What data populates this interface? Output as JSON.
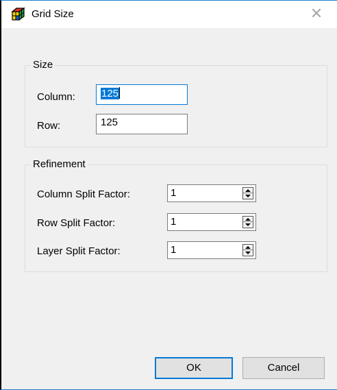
{
  "window": {
    "title": "Grid Size",
    "close_glyph": "✕",
    "icon": "grid-cube-icon"
  },
  "size_group": {
    "legend": "Size",
    "column_label": "Column:",
    "column_value": "125",
    "row_label": "Row:",
    "row_value": "125"
  },
  "refinement_group": {
    "legend": "Refinement",
    "fields": [
      {
        "label": "Column Split Factor:",
        "value": "1"
      },
      {
        "label": "Row Split Factor:",
        "value": "1"
      },
      {
        "label": "Layer Split Factor:",
        "value": "1"
      }
    ]
  },
  "buttons": {
    "ok": "OK",
    "cancel": "Cancel"
  },
  "colors": {
    "accent": "#0078d7",
    "dialog_bg": "#f0f0f0"
  }
}
